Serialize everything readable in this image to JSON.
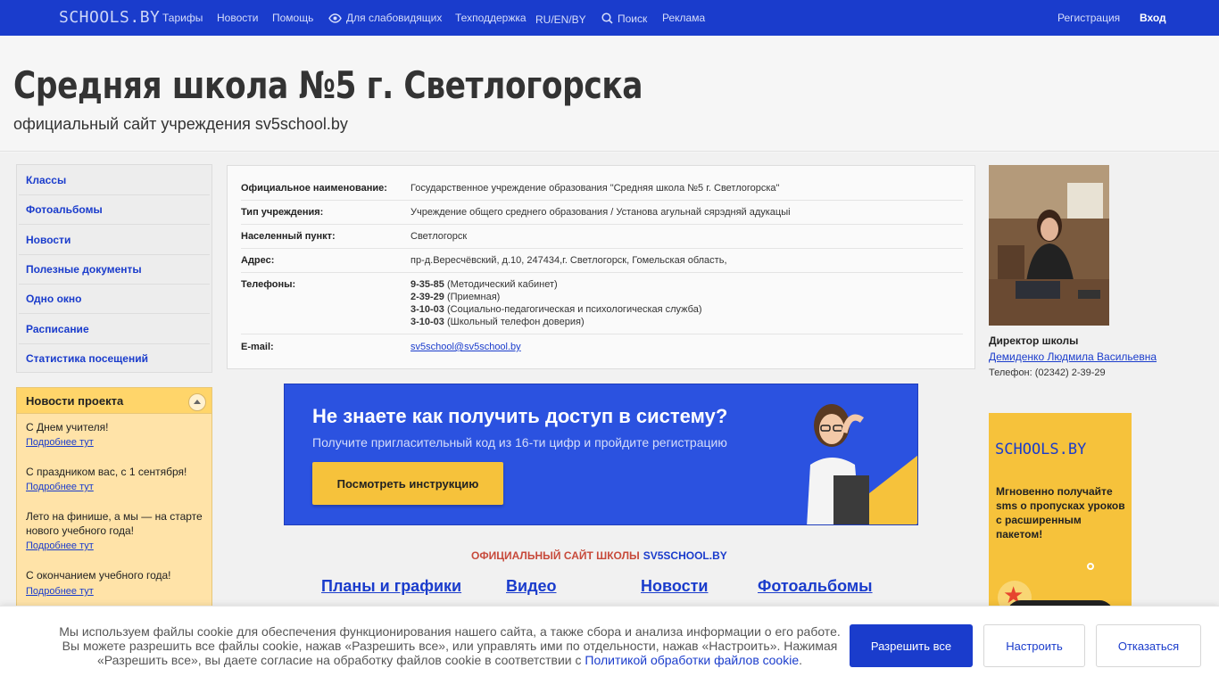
{
  "topnav": {
    "logo": "SCHOOLS.BY",
    "links": [
      "Тарифы",
      "Новости",
      "Помощь"
    ],
    "accessibility": "Для слабовидящих",
    "support": "Техподдержка",
    "langs": "RU/EN/BY",
    "search": "Поиск",
    "ads": "Реклама",
    "register": "Регистрация",
    "login": "Вход"
  },
  "header": {
    "title": "Средняя школа №5 г. Светлогорска",
    "subtitle": "официальный сайт учреждения sv5school.by"
  },
  "sidebar": {
    "items": [
      "Классы",
      "Фотоальбомы",
      "Новости",
      "Полезные документы",
      "Одно окно",
      "Расписание",
      "Статистика посещений"
    ]
  },
  "project_news": {
    "title": "Новости проекта",
    "more_label": "Подробнее тут",
    "items": [
      {
        "title": "С Днем учителя!"
      },
      {
        "title": "С праздником вас, с 1 сентября!"
      },
      {
        "title": "Лето на финише, а мы — на старте нового учебного года!"
      },
      {
        "title": "С окончанием учебного года!"
      }
    ]
  },
  "info": {
    "rows": [
      {
        "label": "Официальное наименование:",
        "value": "Государственное учреждение образования \"Средняя школа №5 г. Светлогорска\""
      },
      {
        "label": "Тип учреждения:",
        "value": "Учреждение общего среднего образования / Установа агульнай сярэдняй адукацыі"
      },
      {
        "label": "Населенный пункт:",
        "value": "Светлогорск"
      },
      {
        "label": "Адрес:",
        "value": "пр-д.Вересчёвский, д.10, 247434,г. Светлогорск, Гомельская область,"
      }
    ],
    "phones_label": "Телефоны:",
    "phones": [
      {
        "number": "9-35-85",
        "note": "(Методический кабинет)"
      },
      {
        "number": "2-39-29",
        "note": "(Приемная)"
      },
      {
        "number": "3-10-03",
        "note": "(Социально-педагогическая и психологическая служба)"
      },
      {
        "number": "3-10-03",
        "note": "(Школьный телефон доверия)"
      }
    ],
    "email_label": "E-mail:",
    "email": "sv5school@sv5school.by"
  },
  "banner": {
    "title": "Не знаете как получить доступ в систему?",
    "subtitle": "Получите пригласительный код из 16-ти цифр и пройдите регистрацию",
    "button": "Посмотреть инструкцию"
  },
  "official": {
    "label": "ОФИЦИАЛЬНЫЙ САЙТ ШКОЛЫ",
    "link": "SV5SCHOOL.BY"
  },
  "sections": [
    "Планы и графики",
    "Видео",
    "Новости",
    "Фотоальбомы "
  ],
  "director": {
    "role": "Директор школы",
    "name": "Демиденко Людмила Васильевна",
    "phone": "Телефон: (02342) 2-39-29"
  },
  "ad": {
    "logo": "SCHOOLS.BY",
    "text": "Мгновенно получайте sms о пропусках уроков с расширенным пакетом!"
  },
  "cookie": {
    "text": "Мы используем файлы cookie для обеспечения функционирования нашего сайта, а также сбора и анализа информации о его работе. Вы можете разрешить все файлы cookie, нажав «Разрешить все», или управлять ими по отдельности, нажав «Настроить». Нажимая «Разрешить все», вы даете согласие на обработку файлов cookie в соответствии с",
    "policy_link": "Политикой обработки файлов cookie",
    "allow": "Разрешить все",
    "configure": "Настроить",
    "refuse": "Отказаться"
  },
  "colors": {
    "brand_blue": "#1a3ccc",
    "accent_yellow": "#f6c23b",
    "news_bg": "#ffe3a8"
  }
}
